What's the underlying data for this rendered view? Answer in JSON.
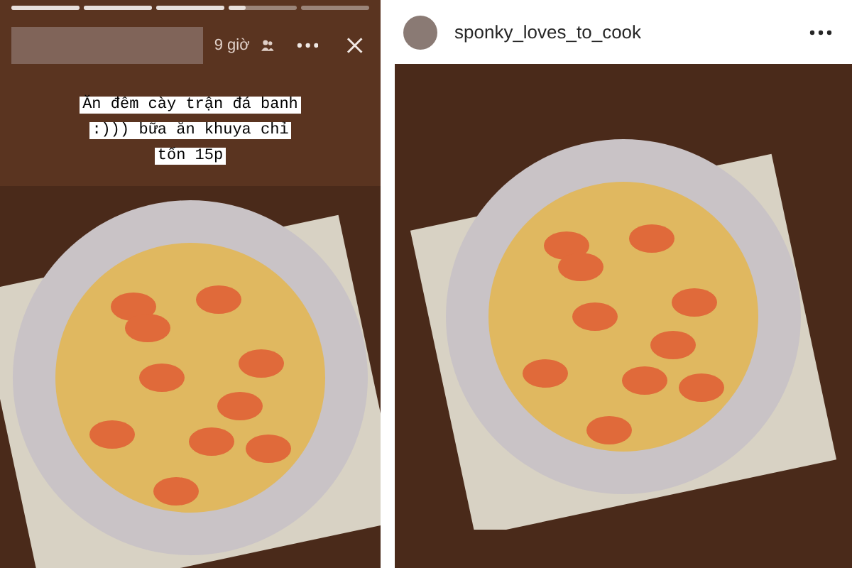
{
  "story": {
    "progress": [
      {
        "level": 1
      },
      {
        "level": 1
      },
      {
        "level": 1
      },
      {
        "level": 0.25
      },
      {
        "level": 0
      }
    ],
    "time": "9 giờ",
    "caption": "Ăn đêm cày trận đá banh :))) bữa ăn khuya chỉ tốn 15p"
  },
  "post": {
    "username": "sponky_loves_to_cook"
  }
}
